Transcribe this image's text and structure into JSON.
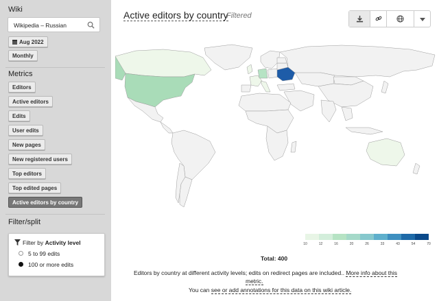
{
  "sidebar": {
    "wiki_heading": "Wiki",
    "wiki_value": "Wikipedia – Russian",
    "date_label": "Aug 2022",
    "granularity_label": "Monthly",
    "metrics_heading": "Metrics",
    "metrics": [
      "Editors",
      "Active editors",
      "Edits",
      "User edits",
      "New pages",
      "New registered users",
      "Top editors",
      "Top edited pages",
      "Active editors by country"
    ],
    "active_metric": "Active editors by country",
    "filter_heading": "Filter/split",
    "filter_by_prefix": "Filter by",
    "filter_by_value": "Activity level",
    "filter_options": [
      {
        "label": "5 to 99 edits",
        "selected": false
      },
      {
        "label": "100 or more edits",
        "selected": true
      }
    ]
  },
  "main": {
    "title": "Active editors by country",
    "filtered_label": "Filtered",
    "toolbar_icons": [
      "download-icon",
      "link-icon",
      "globe-icon",
      "chevron-down-icon"
    ],
    "legend_ticks": [
      "10",
      "12",
      "16",
      "20",
      "26",
      "33",
      "43",
      "54",
      "70"
    ],
    "legend_colors": [
      "#e8f5e6",
      "#d3eedb",
      "#b6e3c4",
      "#a5d9c9",
      "#86c8cd",
      "#5eafcc",
      "#3e8fc0",
      "#1e6aa8",
      "#0b4a8a"
    ],
    "total_text": "Total: 400",
    "desc_line1": "Editors by country at different activity levels; edits on redirect pages are included..",
    "more_info_link": "More info about this",
    "more_info_link2": "metric.",
    "annotations_prefix": "You can",
    "annotations_link": "see or add annotations for this data on this wiki article."
  },
  "colors": {
    "sidebar_bg": "#d8d8d8",
    "active_metric_bg": "#777777",
    "map_default": "#f2f2f2",
    "ukraine": "#1e5ca8",
    "usa": "#a9dcb8",
    "germany": "#b6e3c4",
    "light_green": "#eef7ea"
  }
}
